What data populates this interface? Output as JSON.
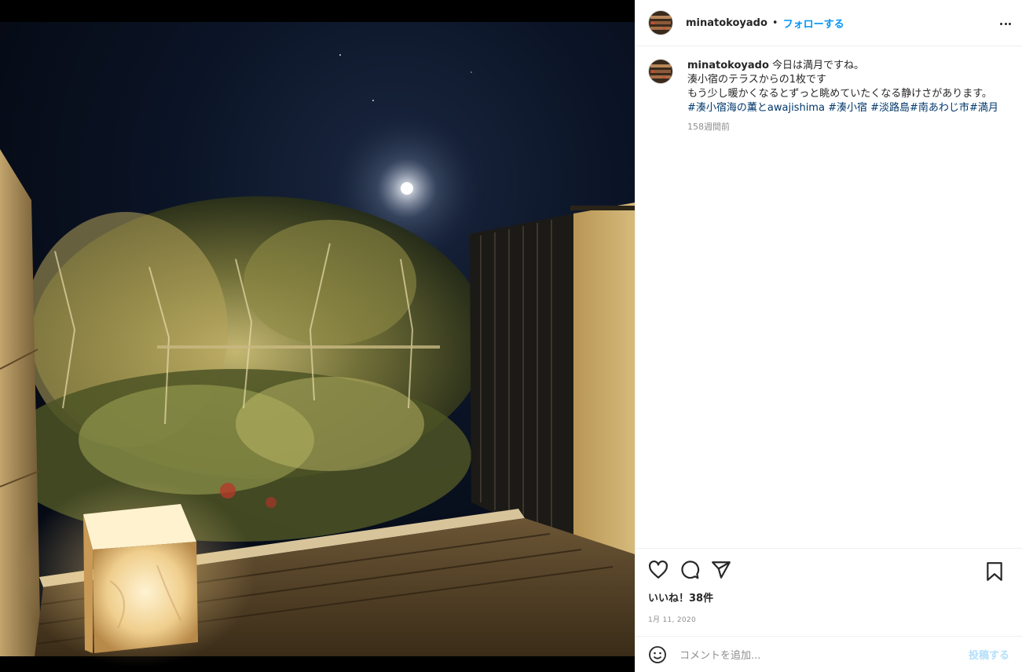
{
  "post": {
    "username": "minatokoyado",
    "follow_label": "フォローする",
    "separator": "•",
    "caption_line1": "今日は満月ですね。",
    "caption_line2": "湊小宿のテラスからの1枚です",
    "caption_line3": "もう少し暖かくなるとずっと眺めていたくなる静けさがあります。",
    "hashtags": [
      "#湊小宿海の薫とawajishima",
      "#湊小宿",
      "#淡路島",
      "#南あわじ市",
      "#満月"
    ],
    "time_ago": "158週間前",
    "likes": "いいね！38件",
    "date": "1月 11, 2020",
    "comment_placeholder": "コメントを追加...",
    "post_label": "投稿する"
  },
  "colors": {
    "accent": "#0095f6",
    "hashtag": "#00376b",
    "muted": "#8e8e8e",
    "post_disabled": "#b2dffc"
  },
  "icons": [
    "more-options-icon",
    "heart-icon",
    "comment-icon",
    "share-icon",
    "bookmark-icon",
    "emoji-icon"
  ]
}
